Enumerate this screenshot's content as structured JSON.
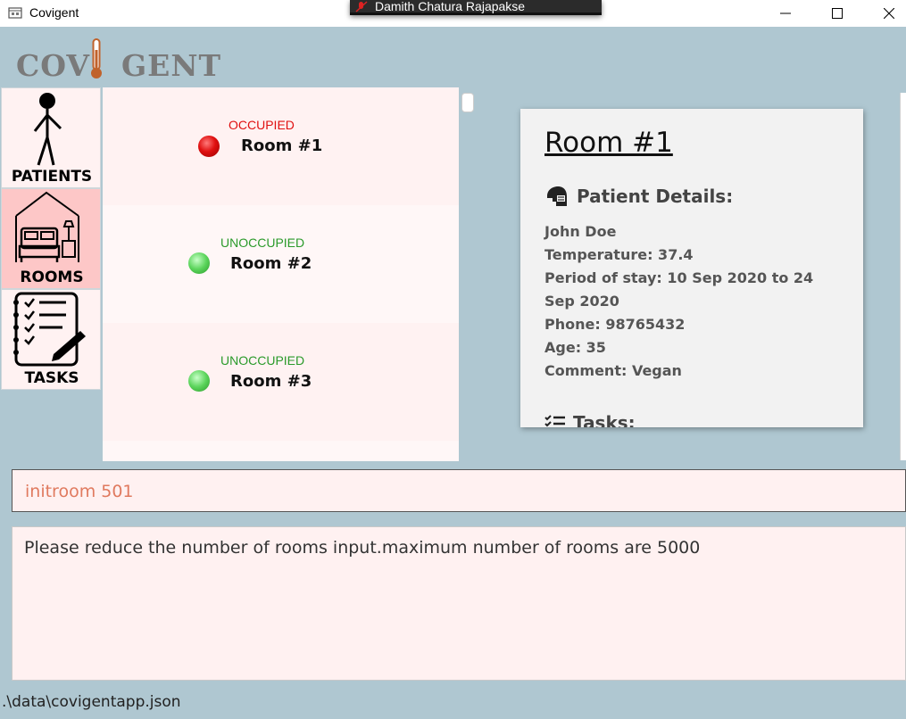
{
  "window": {
    "title": "Covigent",
    "overlay_name": "Damith Chatura Rajapakse"
  },
  "logo": {
    "text_left": "COV",
    "text_right": "GENT"
  },
  "sidebar": {
    "items": [
      {
        "label": "PATIENTS",
        "icon": "stick-figure-icon",
        "active": false
      },
      {
        "label": "ROOMS",
        "icon": "bedroom-icon",
        "active": true
      },
      {
        "label": "TASKS",
        "icon": "checklist-icon",
        "active": false
      }
    ]
  },
  "rooms": [
    {
      "status": "OCCUPIED",
      "name": "Room #1",
      "color": "#e01010"
    },
    {
      "status": "UNOCCUPIED",
      "name": "Room #2",
      "color": "#2a9a2a"
    },
    {
      "status": "UNOCCUPIED",
      "name": "Room #3",
      "color": "#2a9a2a"
    }
  ],
  "detail": {
    "room_title": "Room #1",
    "patient_heading": "Patient Details:",
    "lines": [
      "John Doe",
      "Temperature: 37.4",
      "Period of stay: 10 Sep 2020 to 24 Sep 2020",
      "Phone: 98765432",
      "Age: 35",
      "Comment: Vegan"
    ],
    "tasks_heading": "Tasks:"
  },
  "command": {
    "value": "initroom 501"
  },
  "result": {
    "text": "Please reduce the number of rooms input.maximum number of rooms are 5000"
  },
  "status_bar": {
    "path": ".\\data\\covigentapp.json"
  },
  "colors": {
    "background": "#afc7d1",
    "panel": "#fff2f2",
    "active_tab": "#fdc7c7",
    "occupied": "#e01010",
    "unoccupied": "#2a9a2a",
    "command_text": "#e07a5f"
  }
}
